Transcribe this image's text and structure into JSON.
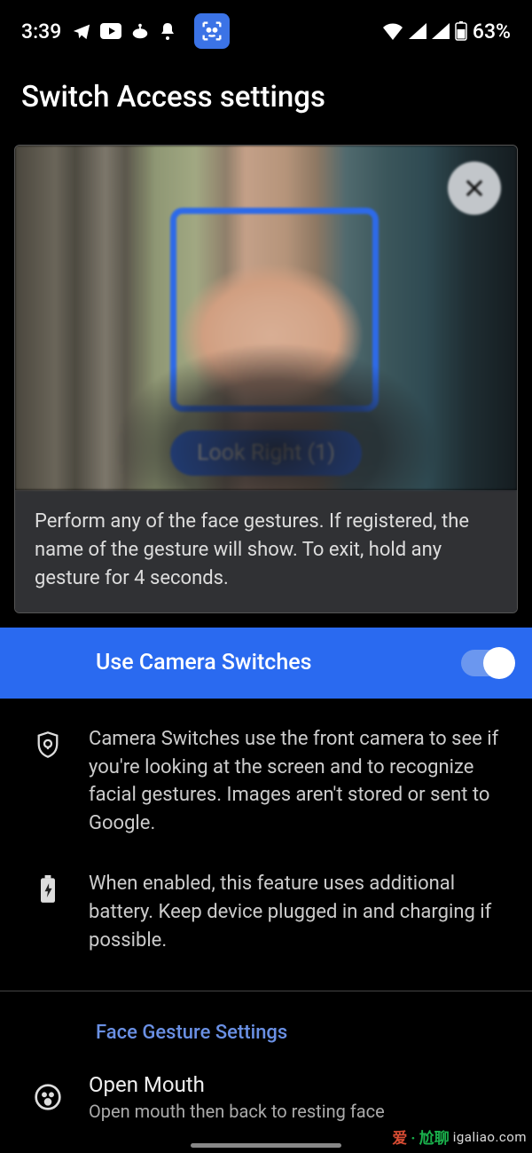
{
  "statusbar": {
    "time": "3:39",
    "battery_text": "63%"
  },
  "page": {
    "title": "Switch Access settings"
  },
  "preview": {
    "gesture_label": "Look Right (1)",
    "instruction": "Perform any of the face gestures. If registered, the name of the gesture will show. To exit, hold any gesture for 4 seconds."
  },
  "toggle": {
    "label": "Use Camera Switches",
    "enabled": true
  },
  "info": {
    "privacy": "Camera Switches use the front camera to see if you're looking at the screen and to recognize facial gestures. Images aren't stored or sent to Google.",
    "battery": "When enabled, this feature uses additional battery. Keep device plugged in and charging if possible."
  },
  "face_section": {
    "header": "Face Gesture Settings",
    "items": [
      {
        "title": "Open Mouth",
        "subtitle": "Open mouth then back to resting face"
      }
    ]
  },
  "watermark": {
    "a": "爱",
    "b": "· 尬聊",
    "c": "igaliao.com"
  }
}
